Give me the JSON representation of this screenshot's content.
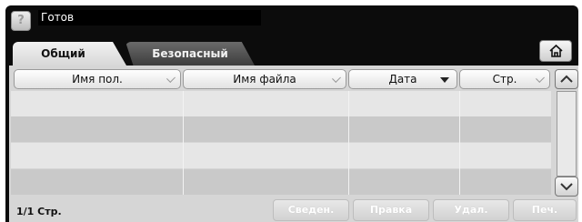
{
  "status": {
    "help_label": "?",
    "text": "Готов"
  },
  "tabs": [
    {
      "label": "Общий",
      "active": true
    },
    {
      "label": "Безопасный",
      "active": false
    }
  ],
  "home": {
    "icon": "home-icon"
  },
  "table": {
    "columns": [
      {
        "label": "Имя пол.",
        "indicator": "check"
      },
      {
        "label": "Имя файла",
        "indicator": "check"
      },
      {
        "label": "Дата",
        "indicator": "sort-down"
      },
      {
        "label": "Стр.",
        "indicator": "check"
      }
    ],
    "rows": [
      [
        "",
        "",
        "",
        ""
      ],
      [
        "",
        "",
        "",
        ""
      ],
      [
        "",
        "",
        "",
        ""
      ],
      [
        "",
        "",
        "",
        ""
      ]
    ]
  },
  "scroll": {
    "up_icon": "chevron-up-icon",
    "down_icon": "chevron-down-icon"
  },
  "footer": {
    "page_info": "1/1 Стр.",
    "buttons": {
      "details": "Сведен.",
      "edit": "Правка",
      "delete": "Удал.",
      "print": "Печ."
    }
  },
  "colors": {
    "frame": "#0c0c0c",
    "content_bg": "#d6d6d6",
    "row_light": "#e6e6e6",
    "row_dark": "#c9c9c9"
  }
}
